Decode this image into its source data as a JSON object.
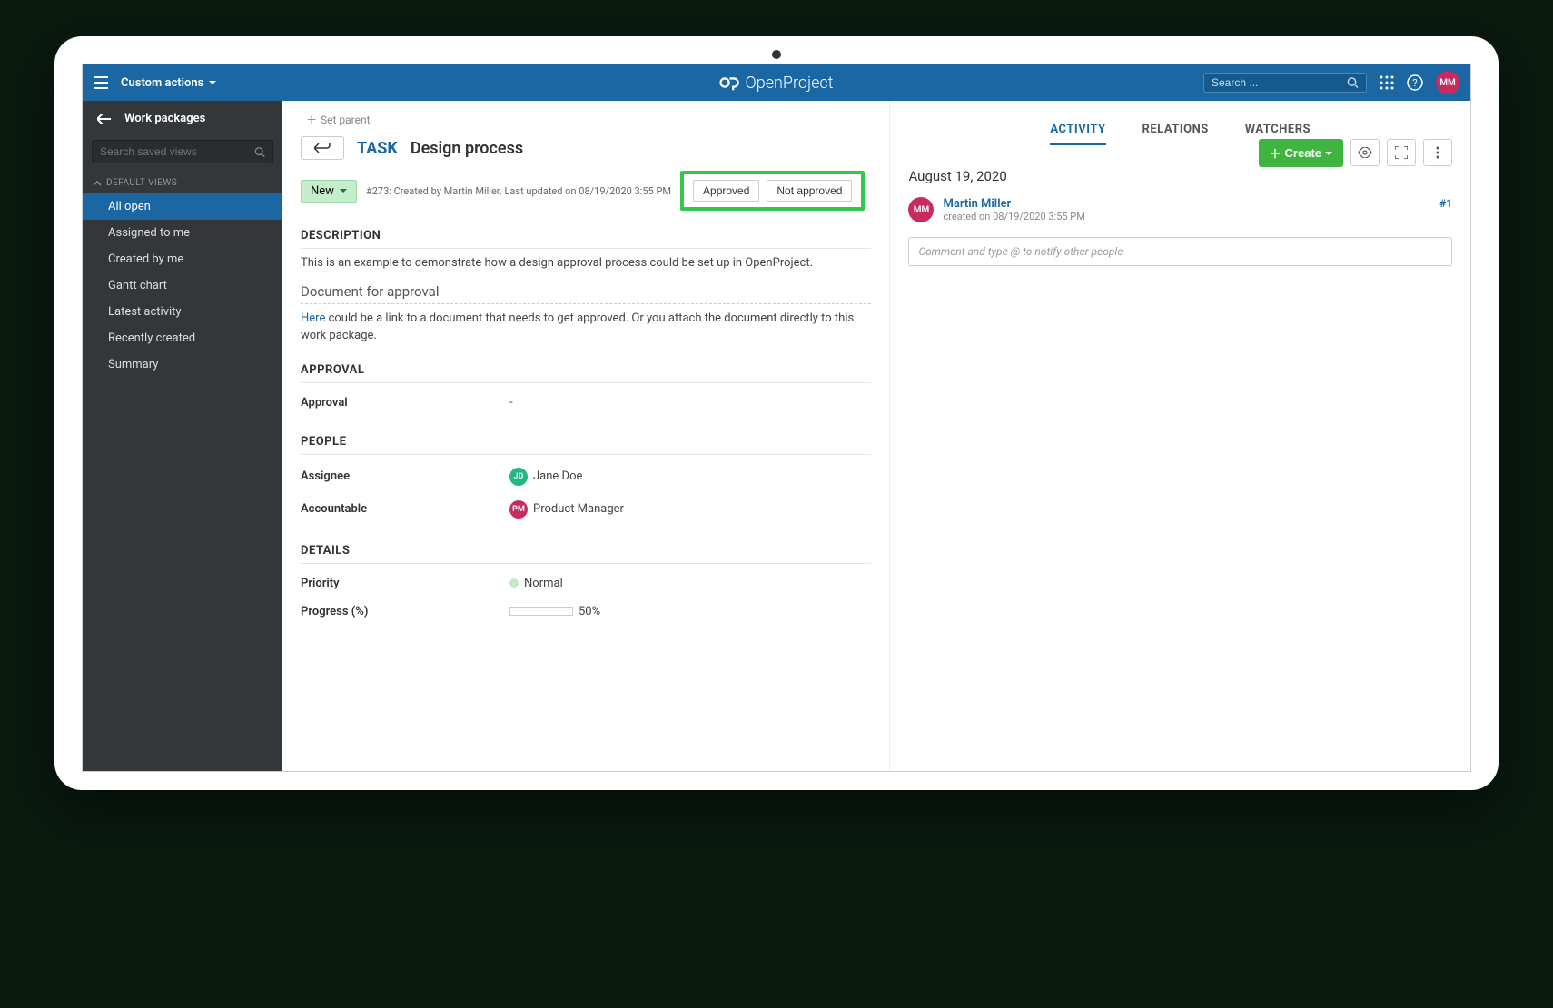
{
  "header": {
    "breadcrumb": "Custom actions",
    "search_placeholder": "Search ...",
    "avatar_initials": "MM",
    "logo_text": "OpenProject"
  },
  "sidebar": {
    "title": "Work packages",
    "search_placeholder": "Search saved views",
    "group_label": "DEFAULT VIEWS",
    "items": [
      {
        "label": "All open",
        "active": true
      },
      {
        "label": "Assigned to me",
        "active": false
      },
      {
        "label": "Created by me",
        "active": false
      },
      {
        "label": "Gantt chart",
        "active": false
      },
      {
        "label": "Latest activity",
        "active": false
      },
      {
        "label": "Recently created",
        "active": false
      },
      {
        "label": "Summary",
        "active": false
      }
    ]
  },
  "toolbar": {
    "set_parent": "Set parent",
    "create_label": "Create"
  },
  "wp": {
    "type": "TASK",
    "title": "Design process",
    "status": "New",
    "meta": "#273: Created by Martin Miller. Last updated on 08/19/2020 3:55 PM",
    "action_approved": "Approved",
    "action_not_approved": "Not approved",
    "desc_head": "DESCRIPTION",
    "desc_p1": "This is an example to demonstrate how a design approval process could be set up in OpenProject.",
    "desc_subhead": "Document for approval",
    "desc_link": "Here",
    "desc_p2_rest": " could be a link to a document that needs to get approved. Or you attach the document directly to this work package.",
    "approval_head": "APPROVAL",
    "approval_label": "Approval",
    "approval_value": "-",
    "people_head": "PEOPLE",
    "assignee_label": "Assignee",
    "assignee_initials": "JD",
    "assignee_name": "Jane Doe",
    "accountable_label": "Accountable",
    "accountable_initials": "PM",
    "accountable_name": "Product Manager",
    "details_head": "DETAILS",
    "priority_label": "Priority",
    "priority_value": "Normal",
    "progress_label": "Progress (%)",
    "progress_value": "50%",
    "progress_pct": 50
  },
  "tabs": {
    "activity": "ACTIVITY",
    "relations": "RELATIONS",
    "watchers": "WATCHERS"
  },
  "activity": {
    "date": "August 19, 2020",
    "entry": {
      "initials": "MM",
      "name": "Martin Miller",
      "meta": "created on 08/19/2020 3:55 PM",
      "num": "#1"
    },
    "comment_placeholder": "Comment and type @ to notify other people"
  }
}
